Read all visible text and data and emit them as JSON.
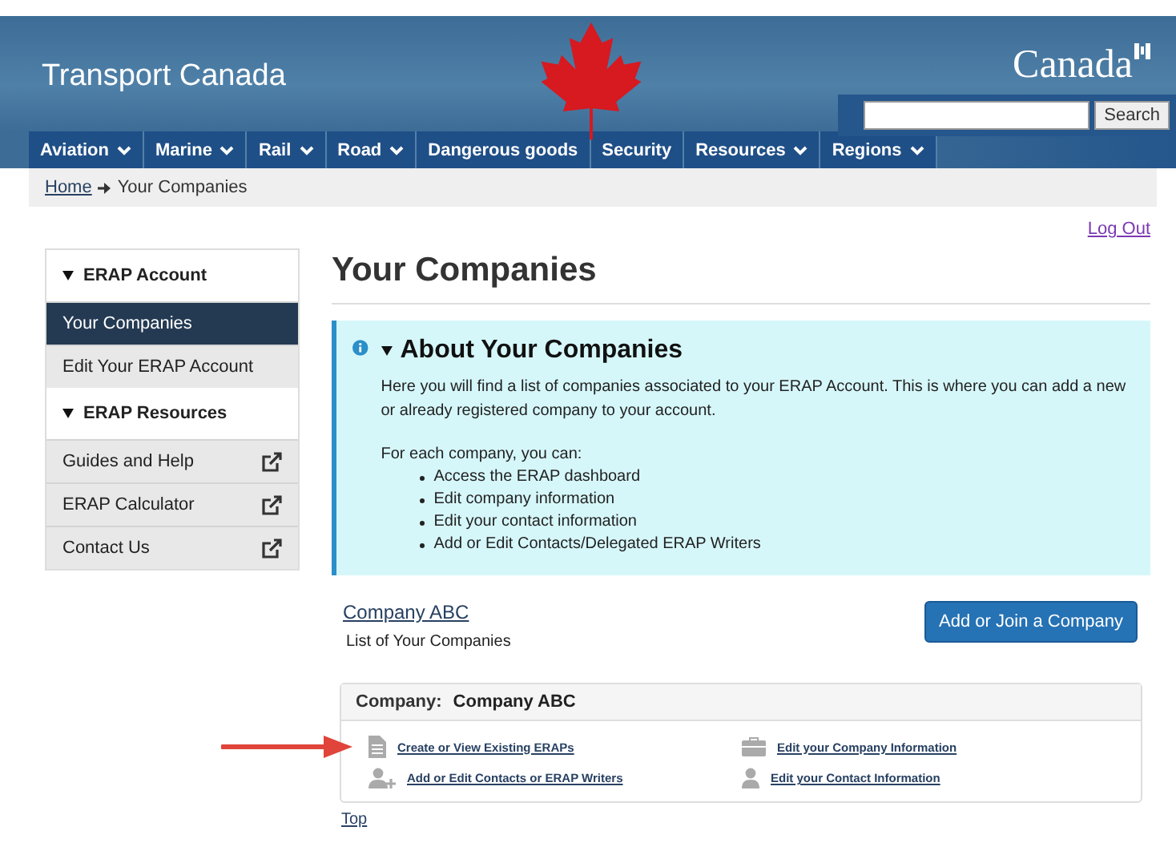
{
  "header": {
    "site_title": "Transport Canada",
    "wordmark": "Canada",
    "search": {
      "button": "Search"
    }
  },
  "nav": [
    {
      "label": "Aviation",
      "has_menu": true
    },
    {
      "label": "Marine",
      "has_menu": true
    },
    {
      "label": "Rail",
      "has_menu": true
    },
    {
      "label": "Road",
      "has_menu": true
    },
    {
      "label": "Dangerous goods",
      "has_menu": false
    },
    {
      "label": "Security",
      "has_menu": false
    },
    {
      "label": "Resources",
      "has_menu": true
    },
    {
      "label": "Regions",
      "has_menu": true
    }
  ],
  "breadcrumb": {
    "home": "Home",
    "current": "Your Companies"
  },
  "logout": "Log Out",
  "sidebar": [
    {
      "kind": "heading",
      "label": "ERAP Account",
      "expanded": true
    },
    {
      "kind": "link",
      "label": "Your Companies",
      "selected": true,
      "external": false
    },
    {
      "kind": "link",
      "label": "Edit Your ERAP Account",
      "selected": false,
      "external": false
    },
    {
      "kind": "heading",
      "label": "ERAP Resources",
      "expanded": true
    },
    {
      "kind": "link",
      "label": "Guides and Help",
      "selected": false,
      "external": true
    },
    {
      "kind": "link",
      "label": "ERAP Calculator",
      "selected": false,
      "external": true
    },
    {
      "kind": "link",
      "label": "Contact Us",
      "selected": false,
      "external": true
    }
  ],
  "page_title": "Your Companies",
  "about": {
    "title": "About Your Companies",
    "expanded": true,
    "intro": "Here you will find a list of companies associated to your ERAP Account. This is where you can add a new or already registered company to your account.",
    "list_intro": "For each company, you can:",
    "items": [
      "Access the ERAP dashboard",
      "Edit company information",
      "Edit your contact information",
      "Add or Edit Contacts/Delegated ERAP Writers"
    ]
  },
  "company_link": "Company ABC",
  "add_button": "Add or Join a Company",
  "list_caption": "List of Your Companies",
  "company_panel": {
    "label": "Company:",
    "name": "Company ABC",
    "links": [
      {
        "kind": "document",
        "label": "Create or View Existing ERAPs",
        "highlighted": true
      },
      {
        "kind": "briefcase",
        "label": "Edit your Company Information",
        "highlighted": false
      },
      {
        "kind": "person-add",
        "label": "Add or Edit Contacts or ERAP Writers",
        "highlighted": false
      },
      {
        "kind": "person",
        "label": "Edit your Contact Information",
        "highlighted": false
      }
    ]
  },
  "top_link": "Top"
}
